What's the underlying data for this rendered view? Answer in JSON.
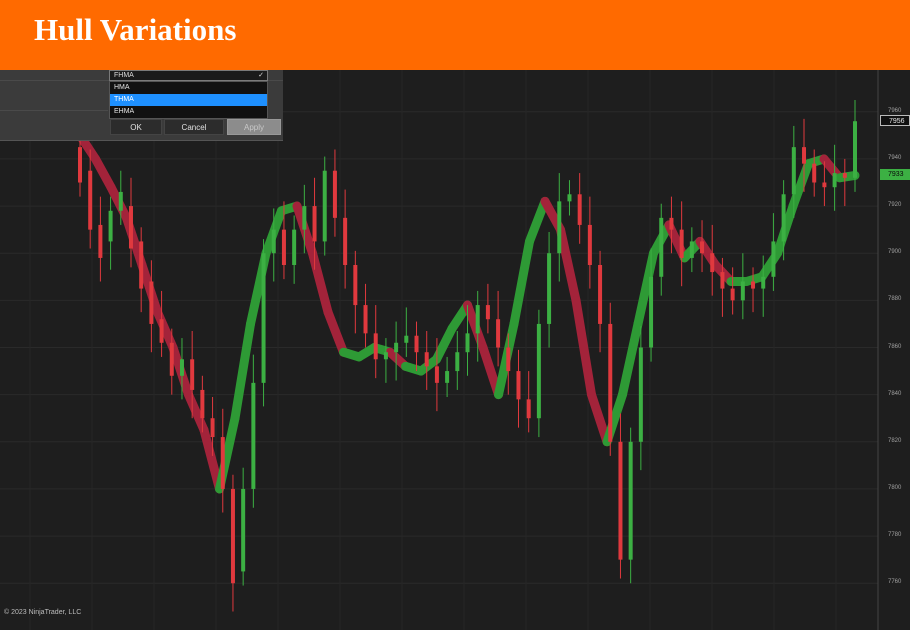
{
  "banner": {
    "title": "Hull Variations"
  },
  "dialog": {
    "select_value": "FHMA",
    "chevron_icon": "chevron-down-icon",
    "options": [
      {
        "label": "HMA",
        "selected": false
      },
      {
        "label": "THMA",
        "selected": true
      },
      {
        "label": "EHMA",
        "selected": false
      }
    ],
    "buttons": {
      "ok": "OK",
      "cancel": "Cancel",
      "apply": "Apply"
    }
  },
  "price_axis": {
    "labels": [
      "7960",
      "7940",
      "7920",
      "7900",
      "7880",
      "7860",
      "7840",
      "7820",
      "7800",
      "7780",
      "7760"
    ],
    "last_price": "7956",
    "hma_price": "7933"
  },
  "footer": {
    "copyright": "© 2023 NinjaTrader, LLC"
  },
  "colors": {
    "banner": "#ff6a00",
    "bull_candle": "#3cb043",
    "bear_candle": "#e0393e",
    "hma_up": "#2e9a35",
    "hma_down": "#a3233a",
    "selected_option": "#1e90ff"
  },
  "chart_data": {
    "type": "candlestick",
    "y_range": [
      7755,
      7965
    ],
    "points": [
      [
        7945,
        7930
      ],
      [
        7935,
        7910
      ],
      [
        7912,
        7898
      ],
      [
        7905,
        7918
      ],
      [
        7918,
        7926
      ],
      [
        7920,
        7902
      ],
      [
        7905,
        7885
      ],
      [
        7888,
        7870
      ],
      [
        7872,
        7862
      ],
      [
        7862,
        7848
      ],
      [
        7848,
        7855
      ],
      [
        7855,
        7842
      ],
      [
        7842,
        7830
      ],
      [
        7830,
        7822
      ],
      [
        7822,
        7800
      ],
      [
        7800,
        7760
      ],
      [
        7765,
        7800
      ],
      [
        7800,
        7845
      ],
      [
        7845,
        7900
      ],
      [
        7900,
        7910
      ],
      [
        7910,
        7895
      ],
      [
        7895,
        7910
      ],
      [
        7910,
        7920
      ],
      [
        7920,
        7905
      ],
      [
        7905,
        7935
      ],
      [
        7935,
        7915
      ],
      [
        7915,
        7895
      ],
      [
        7895,
        7878
      ],
      [
        7878,
        7866
      ],
      [
        7866,
        7855
      ],
      [
        7855,
        7858
      ],
      [
        7858,
        7862
      ],
      [
        7862,
        7865
      ],
      [
        7865,
        7858
      ],
      [
        7858,
        7852
      ],
      [
        7852,
        7845
      ],
      [
        7845,
        7850
      ],
      [
        7850,
        7858
      ],
      [
        7858,
        7866
      ],
      [
        7866,
        7878
      ],
      [
        7878,
        7872
      ],
      [
        7872,
        7860
      ],
      [
        7860,
        7850
      ],
      [
        7850,
        7838
      ],
      [
        7838,
        7830
      ],
      [
        7830,
        7870
      ],
      [
        7870,
        7900
      ],
      [
        7900,
        7922
      ],
      [
        7922,
        7925
      ],
      [
        7925,
        7912
      ],
      [
        7912,
        7895
      ],
      [
        7895,
        7870
      ],
      [
        7870,
        7820
      ],
      [
        7820,
        7770
      ],
      [
        7770,
        7820
      ],
      [
        7820,
        7860
      ],
      [
        7860,
        7890
      ],
      [
        7890,
        7915
      ],
      [
        7915,
        7910
      ],
      [
        7910,
        7898
      ],
      [
        7898,
        7905
      ],
      [
        7905,
        7900
      ],
      [
        7900,
        7892
      ],
      [
        7892,
        7885
      ],
      [
        7885,
        7880
      ],
      [
        7880,
        7888
      ],
      [
        7888,
        7885
      ],
      [
        7885,
        7890
      ],
      [
        7890,
        7905
      ],
      [
        7905,
        7925
      ],
      [
        7925,
        7945
      ],
      [
        7945,
        7938
      ],
      [
        7938,
        7930
      ],
      [
        7930,
        7928
      ],
      [
        7928,
        7934
      ],
      [
        7934,
        7932
      ],
      [
        7932,
        7956
      ]
    ],
    "hma_path": [
      [
        7950,
        "down"
      ],
      [
        7940,
        "down"
      ],
      [
        7928,
        "down"
      ],
      [
        7915,
        "down"
      ],
      [
        7895,
        "down"
      ],
      [
        7875,
        "down"
      ],
      [
        7860,
        "down"
      ],
      [
        7840,
        "down"
      ],
      [
        7825,
        "down"
      ],
      [
        7800,
        "up"
      ],
      [
        7830,
        "up"
      ],
      [
        7870,
        "up"
      ],
      [
        7900,
        "up"
      ],
      [
        7918,
        "up"
      ],
      [
        7920,
        "down"
      ],
      [
        7900,
        "down"
      ],
      [
        7875,
        "down"
      ],
      [
        7858,
        "up"
      ],
      [
        7856,
        "up"
      ],
      [
        7860,
        "up"
      ],
      [
        7858,
        "down"
      ],
      [
        7852,
        "up"
      ],
      [
        7850,
        "up"
      ],
      [
        7855,
        "up"
      ],
      [
        7868,
        "up"
      ],
      [
        7878,
        "down"
      ],
      [
        7860,
        "down"
      ],
      [
        7840,
        "up"
      ],
      [
        7870,
        "up"
      ],
      [
        7905,
        "up"
      ],
      [
        7922,
        "down"
      ],
      [
        7910,
        "down"
      ],
      [
        7880,
        "down"
      ],
      [
        7840,
        "down"
      ],
      [
        7820,
        "up"
      ],
      [
        7840,
        "up"
      ],
      [
        7870,
        "up"
      ],
      [
        7900,
        "up"
      ],
      [
        7912,
        "down"
      ],
      [
        7898,
        "up"
      ],
      [
        7905,
        "down"
      ],
      [
        7895,
        "down"
      ],
      [
        7888,
        "up"
      ],
      [
        7888,
        "up"
      ],
      [
        7890,
        "up"
      ],
      [
        7900,
        "up"
      ],
      [
        7920,
        "up"
      ],
      [
        7938,
        "up"
      ],
      [
        7940,
        "down"
      ],
      [
        7932,
        "up"
      ],
      [
        7933,
        "up"
      ]
    ]
  }
}
